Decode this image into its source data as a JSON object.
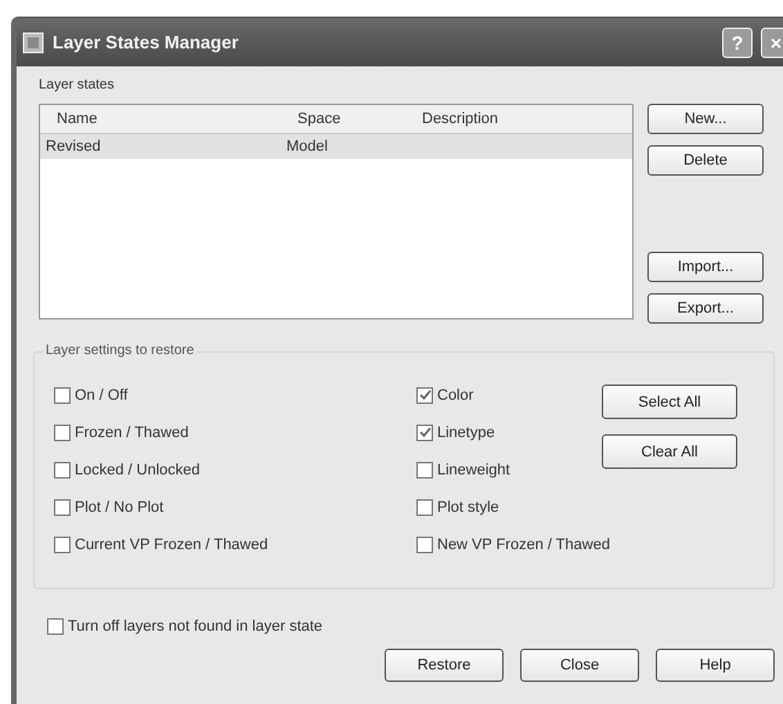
{
  "window": {
    "title": "Layer States Manager",
    "help_button": "?",
    "close_button": "×"
  },
  "layer_states": {
    "label": "Layer states",
    "columns": [
      "Name",
      "Space",
      "Description"
    ],
    "rows": [
      {
        "name": "Revised",
        "space": "Model",
        "description": "",
        "selected": true
      }
    ],
    "buttons": [
      "New...",
      "Delete",
      "Import...",
      "Export..."
    ]
  },
  "settings": {
    "label": "Layer settings to restore",
    "column_1": [
      {
        "label": "On / Off",
        "checked": false
      },
      {
        "label": "Frozen / Thawed",
        "checked": false
      },
      {
        "label": "Locked / Unlocked",
        "checked": false
      },
      {
        "label": "Plot / No Plot",
        "checked": false
      },
      {
        "label": "Current VP Frozen / Thawed",
        "checked": false
      }
    ],
    "column_2": [
      {
        "label": "Color",
        "checked": true
      },
      {
        "label": "Linetype",
        "checked": true
      },
      {
        "label": "Lineweight",
        "checked": false
      },
      {
        "label": "Plot style",
        "checked": false
      },
      {
        "label": "New VP Frozen / Thawed",
        "checked": false
      }
    ],
    "buttons": [
      "Select All",
      "Clear All"
    ]
  },
  "turn_off_option": {
    "label": "Turn off layers not found in layer state",
    "checked": false
  },
  "footer_buttons": [
    "Restore",
    "Close",
    "Help"
  ]
}
